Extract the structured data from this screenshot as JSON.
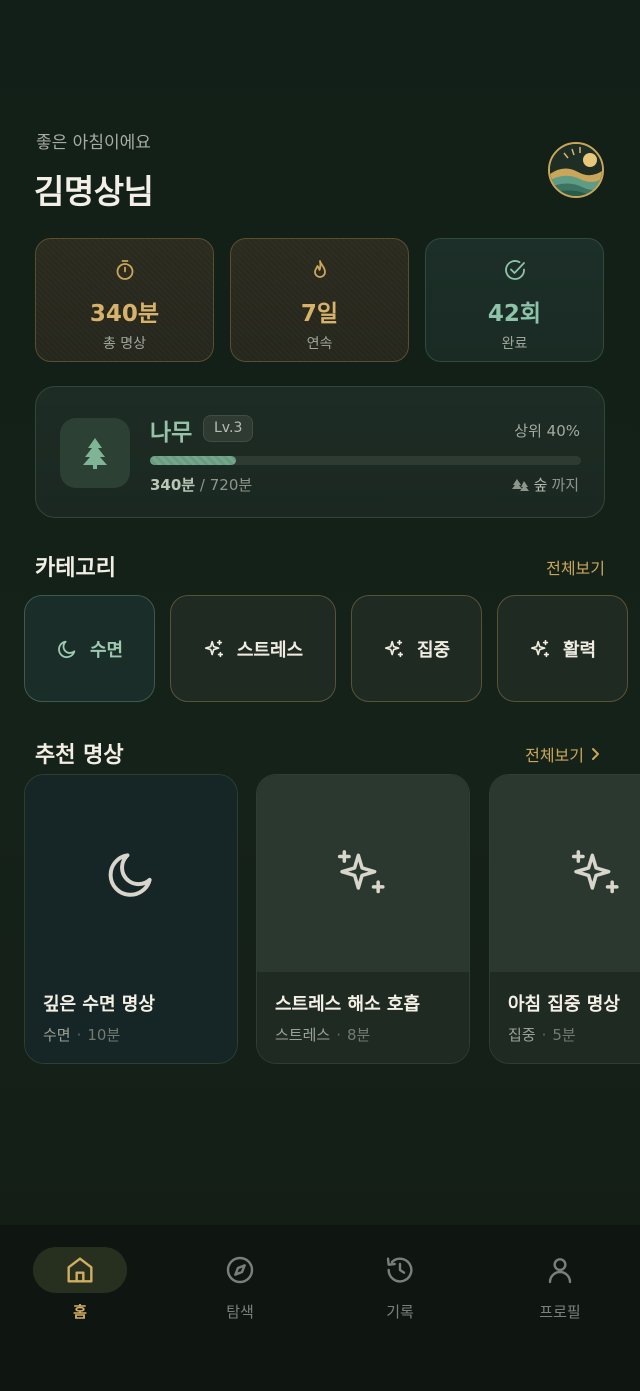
{
  "greeting": {
    "subtitle": "좋은 아침이에요",
    "name": "김명상님"
  },
  "stats": [
    {
      "icon": "timer-icon",
      "value": "340분",
      "label": "총 명상"
    },
    {
      "icon": "flame-icon",
      "value": "7일",
      "label": "연속"
    },
    {
      "icon": "check-circle-icon",
      "value": "42회",
      "label": "완료"
    }
  ],
  "level": {
    "stage": "나무",
    "badge": "Lv.3",
    "rank": "상위 40%",
    "current": "340분",
    "target": "/ 720분",
    "progress": 0.2,
    "next_stage": "숲",
    "next_suffix": "까지"
  },
  "categories": {
    "title": "카테고리",
    "more": "전체보기",
    "items": [
      {
        "label": "수면",
        "icon": "moon-icon"
      },
      {
        "label": "스트레스",
        "icon": "sparkles-icon"
      },
      {
        "label": "집중",
        "icon": "sparkles-icon"
      },
      {
        "label": "활력",
        "icon": "sparkles-icon"
      }
    ]
  },
  "recommended": {
    "title": "추천 명상",
    "more": "전체보기",
    "items": [
      {
        "title": "깊은 수면 명상",
        "category": "수면",
        "duration": "10분",
        "icon": "moon-icon"
      },
      {
        "title": "스트레스 해소 호흡",
        "category": "스트레스",
        "duration": "8분",
        "icon": "sparkles-icon"
      },
      {
        "title": "아침 집중 명상",
        "category": "집중",
        "duration": "5분",
        "icon": "sparkles-icon"
      }
    ]
  },
  "nav": [
    {
      "label": "홈",
      "icon": "home-icon",
      "active": true
    },
    {
      "label": "탐색",
      "icon": "compass-icon"
    },
    {
      "label": "기록",
      "icon": "history-icon"
    },
    {
      "label": "프로필",
      "icon": "user-icon"
    }
  ],
  "colors": {
    "accent_gold": "#c9a65a",
    "accent_green": "#8dc4a9",
    "background": "#131f18"
  }
}
